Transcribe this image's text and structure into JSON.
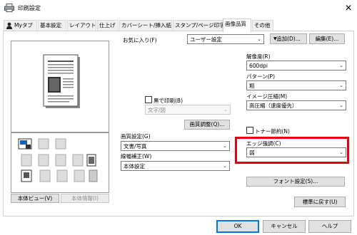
{
  "window": {
    "title": "印刷設定"
  },
  "tabs": [
    "Myタブ",
    "基本設定",
    "レイアウト",
    "仕上げ",
    "カバーシート/挿入紙",
    "スタンプ/ページ印字",
    "画像品質",
    "その他"
  ],
  "left": {
    "view_button": "本体ビュー(V)",
    "info_button": "本体情報(I)"
  },
  "favorites": {
    "label": "お気に入り(F)",
    "value": "ユーザー設定",
    "add_button": "追加(D)...",
    "edit_button": "編集(E)..."
  },
  "bw_print": {
    "label": "黒で印刷(B)",
    "value": "文字/図"
  },
  "image_adjust_button": "画質調整(Q)...",
  "quality": {
    "label": "画質設定(G)",
    "value": "文書/写真"
  },
  "line_width": {
    "label": "線幅補正(W)",
    "value": "本体設定"
  },
  "resolution": {
    "label": "解像度(R)",
    "value": "600dpi"
  },
  "pattern": {
    "label": "パターン(P)",
    "value": "粗"
  },
  "compression": {
    "label": "イメージ圧縮(M)",
    "value": "高圧縮（速度優先）"
  },
  "toner_save": {
    "label": "トナー節約(N)"
  },
  "edge": {
    "label": "エッジ強調(C)",
    "value": "弱"
  },
  "font_settings_button": "フォント設定(S)...",
  "reset_button": "標準に戻す(U)",
  "footer": {
    "ok": "OK",
    "cancel": "キャンセル",
    "help": "ヘルプ"
  }
}
